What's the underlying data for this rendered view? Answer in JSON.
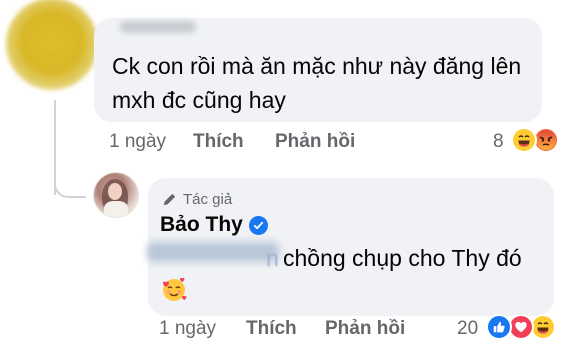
{
  "comment1": {
    "text_line1": "Ck con rồi mà ăn mặc như này đăng lên",
    "text_line2": "mxh đc cũng hay",
    "time": "1 ngày",
    "like": "Thích",
    "reply": "Phản hồi",
    "reaction_count": "8",
    "reactions": [
      "laughing-emoji",
      "angry-emoji"
    ]
  },
  "comment2": {
    "author_badge": "Tác giả",
    "author_name": "Bảo Thy",
    "text_tail": "n",
    "text": "chồng chụp cho Thy đó",
    "emoji": "smiling-face-with-hearts-emoji",
    "time": "1 ngày",
    "like": "Thích",
    "reply": "Phản hồi",
    "reaction_count": "20",
    "reactions": [
      "like-icon",
      "love-icon",
      "laughing-emoji"
    ]
  },
  "colors": {
    "bubble": "#f0f2f5",
    "meta_text": "#65676b",
    "like_blue": "#1877f2",
    "love_red": "#f33e58",
    "emoji_yellow": "#ffcc33"
  }
}
